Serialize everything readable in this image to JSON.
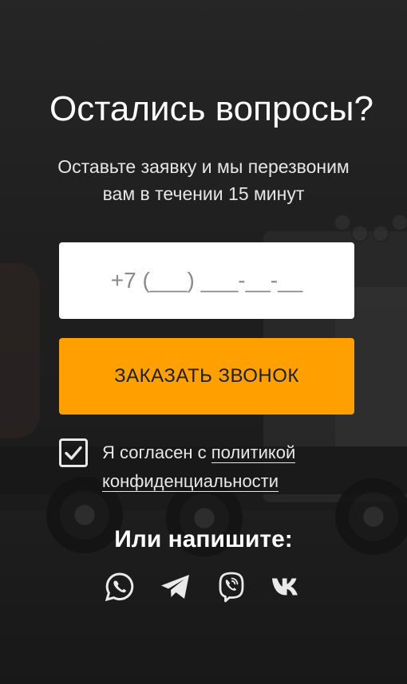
{
  "form": {
    "title": "Остались вопросы?",
    "subtitle_line1": "Оставьте заявку и мы перезвоним",
    "subtitle_line2": "вам в течении 15 минут",
    "phone_placeholder": "+7 (___) ___-__-__",
    "phone_value": "",
    "order_button_label": "ЗАКАЗАТЬ ЗВОНОК",
    "consent": {
      "checked": true,
      "text_prefix": "Я согласен с",
      "link_text_1": "политикой",
      "link_text_2": "конфиденциальности"
    },
    "write_title": "Или напишите:"
  },
  "socials": [
    {
      "name": "whatsapp-icon"
    },
    {
      "name": "telegram-icon"
    },
    {
      "name": "viber-icon"
    },
    {
      "name": "vk-icon"
    }
  ],
  "colors": {
    "accent": "#ffa000",
    "input_bg": "#ffffff",
    "text": "#ffffff"
  }
}
